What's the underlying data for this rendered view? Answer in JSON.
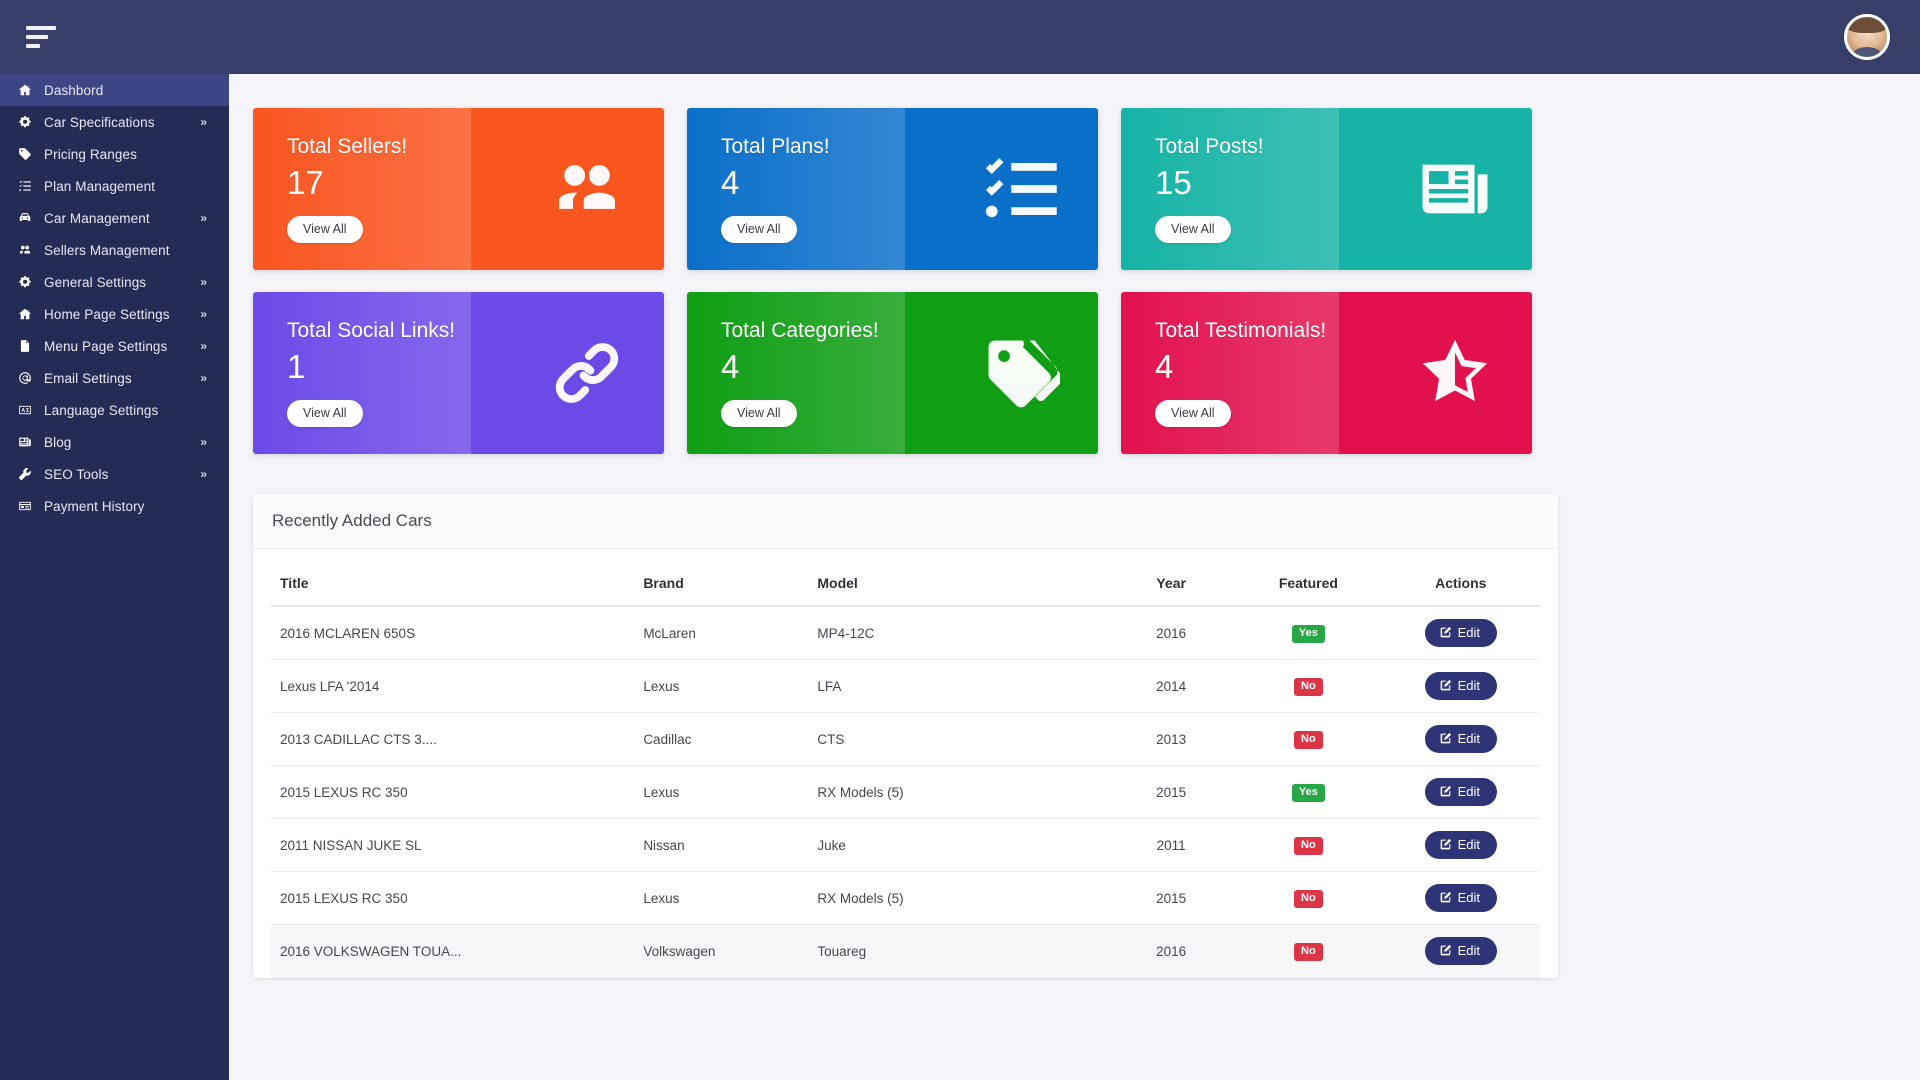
{
  "topbar": {
    "menu_toggle_label": "menu-toggle",
    "avatar_label": "user-avatar"
  },
  "sidebar": {
    "items": [
      {
        "label": "Dashbord",
        "icon": "home-icon",
        "active": true,
        "chevron": ""
      },
      {
        "label": "Car Specifications",
        "icon": "gears-icon",
        "active": false,
        "chevron": "»"
      },
      {
        "label": "Pricing Ranges",
        "icon": "tag-icon",
        "active": false,
        "chevron": ""
      },
      {
        "label": "Plan Management",
        "icon": "list-icon",
        "active": false,
        "chevron": ""
      },
      {
        "label": "Car Management",
        "icon": "car-icon",
        "active": false,
        "chevron": "»"
      },
      {
        "label": "Sellers Management",
        "icon": "users-icon",
        "active": false,
        "chevron": ""
      },
      {
        "label": "General Settings",
        "icon": "gears-icon",
        "active": false,
        "chevron": "»"
      },
      {
        "label": "Home Page Settings",
        "icon": "home-icon",
        "active": false,
        "chevron": "»"
      },
      {
        "label": "Menu Page Settings",
        "icon": "file-icon",
        "active": false,
        "chevron": "»"
      },
      {
        "label": "Email Settings",
        "icon": "at-icon",
        "active": false,
        "chevron": "»"
      },
      {
        "label": "Language Settings",
        "icon": "language-icon",
        "active": false,
        "chevron": ""
      },
      {
        "label": "Blog",
        "icon": "newspaper-icon",
        "active": false,
        "chevron": "»"
      },
      {
        "label": "SEO Tools",
        "icon": "wrench-icon",
        "active": false,
        "chevron": "»"
      },
      {
        "label": "Payment History",
        "icon": "card-icon",
        "active": false,
        "chevron": ""
      }
    ]
  },
  "cards": [
    {
      "title": "Total Sellers!",
      "value": "17",
      "button": "View All",
      "icon": "users-icon",
      "color_from": "#f9551f",
      "color_to": "#f06712",
      "name": "total-sellers"
    },
    {
      "title": "Total Plans!",
      "value": "4",
      "button": "View All",
      "icon": "checklist-icon",
      "color_from": "#0a6fc9",
      "color_to": "#1b9ff0",
      "name": "total-plans"
    },
    {
      "title": "Total Posts!",
      "value": "15",
      "button": "View All",
      "icon": "newspaper-icon",
      "color_from": "#16b3a6",
      "color_to": "#0fada2",
      "name": "total-posts"
    },
    {
      "title": "Total Social Links!",
      "value": "1",
      "button": "View All",
      "icon": "link-icon",
      "color_from": "#6c4ae8",
      "color_to": "#3b3188",
      "name": "total-social-links"
    },
    {
      "title": "Total Categories!",
      "value": "4",
      "button": "View All",
      "icon": "tags-icon",
      "color_from": "#0f9e14",
      "color_to": "#1aa51f",
      "name": "total-categories"
    },
    {
      "title": "Total Testimonials!",
      "value": "4",
      "button": "View All",
      "icon": "star-half-icon",
      "color_from": "#e2114e",
      "color_to": "#d60f3f",
      "name": "total-testimonials"
    }
  ],
  "table": {
    "panel_title": "Recently Added Cars",
    "columns": [
      "Title",
      "Brand",
      "Model",
      "Year",
      "Featured",
      "Actions"
    ],
    "action_label": "Edit",
    "rows": [
      {
        "title": "2016 MCLAREN 650S",
        "brand": "McLaren",
        "model": "MP4-12C",
        "year": "2016",
        "featured": "Yes",
        "action": "Edit"
      },
      {
        "title": "Lexus LFA '2014",
        "brand": "Lexus",
        "model": "LFA",
        "year": "2014",
        "featured": "No",
        "action": "Edit"
      },
      {
        "title": "2013 CADILLAC CTS 3....",
        "brand": "Cadillac",
        "model": "CTS",
        "year": "2013",
        "featured": "No",
        "action": "Edit"
      },
      {
        "title": "2015 LEXUS RC 350",
        "brand": "Lexus",
        "model": "RX Models (5)",
        "year": "2015",
        "featured": "Yes",
        "action": "Edit"
      },
      {
        "title": "2011 NISSAN JUKE SL",
        "brand": "Nissan",
        "model": "Juke",
        "year": "2011",
        "featured": "No",
        "action": "Edit"
      },
      {
        "title": "2015 LEXUS RC 350",
        "brand": "Lexus",
        "model": "RX Models (5)",
        "year": "2015",
        "featured": "No",
        "action": "Edit"
      },
      {
        "title": "2016 VOLKSWAGEN TOUA...",
        "brand": "Volkswagen",
        "model": "Touareg",
        "year": "2016",
        "featured": "No",
        "action": "Edit"
      }
    ]
  },
  "colors": {
    "sidebar_bg": "#242b54",
    "sidebar_active": "#3c4684",
    "topbar_bg": "#373f68",
    "page_bg": "#f4f4f9",
    "accent_dark": "#2e3576",
    "badge_yes": "#27a745",
    "badge_no": "#dc3546"
  }
}
